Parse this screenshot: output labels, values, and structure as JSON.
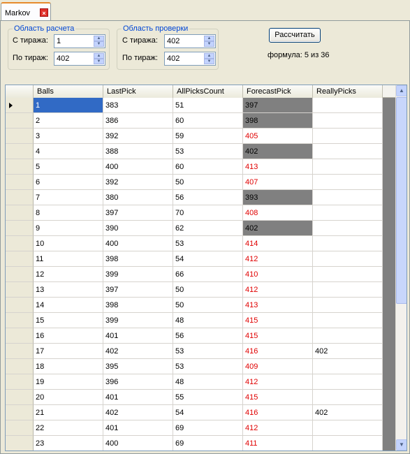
{
  "tab": {
    "label": "Markov",
    "close": "×"
  },
  "calc_group": {
    "title": "Область расчета",
    "from_label": "С тиража:",
    "from_value": "1",
    "to_label": "По тираж:",
    "to_value": "402"
  },
  "check_group": {
    "title": "Область проверки",
    "from_label": "С тиража:",
    "from_value": "402",
    "to_label": "По тираж:",
    "to_value": "402"
  },
  "calculate_button": "Рассчитать",
  "formula_text": "формула: 5 из 36",
  "grid": {
    "columns": [
      "Balls",
      "LastPick",
      "AllPicksCount",
      "ForecastPick",
      "ReallyPicks"
    ],
    "rows": [
      {
        "balls": "1",
        "last": "383",
        "all": "51",
        "forecast": "397",
        "really": "",
        "style": "gray"
      },
      {
        "balls": "2",
        "last": "386",
        "all": "60",
        "forecast": "398",
        "really": "",
        "style": "gray"
      },
      {
        "balls": "3",
        "last": "392",
        "all": "59",
        "forecast": "405",
        "really": "",
        "style": "red"
      },
      {
        "balls": "4",
        "last": "388",
        "all": "53",
        "forecast": "402",
        "really": "",
        "style": "gray"
      },
      {
        "balls": "5",
        "last": "400",
        "all": "60",
        "forecast": "413",
        "really": "",
        "style": "red"
      },
      {
        "balls": "6",
        "last": "392",
        "all": "50",
        "forecast": "407",
        "really": "",
        "style": "red"
      },
      {
        "balls": "7",
        "last": "380",
        "all": "56",
        "forecast": "393",
        "really": "",
        "style": "gray"
      },
      {
        "balls": "8",
        "last": "397",
        "all": "70",
        "forecast": "408",
        "really": "",
        "style": "red"
      },
      {
        "balls": "9",
        "last": "390",
        "all": "62",
        "forecast": "402",
        "really": "",
        "style": "gray"
      },
      {
        "balls": "10",
        "last": "400",
        "all": "53",
        "forecast": "414",
        "really": "",
        "style": "red"
      },
      {
        "balls": "11",
        "last": "398",
        "all": "54",
        "forecast": "412",
        "really": "",
        "style": "red"
      },
      {
        "balls": "12",
        "last": "399",
        "all": "66",
        "forecast": "410",
        "really": "",
        "style": "red"
      },
      {
        "balls": "13",
        "last": "397",
        "all": "50",
        "forecast": "412",
        "really": "",
        "style": "red"
      },
      {
        "balls": "14",
        "last": "398",
        "all": "50",
        "forecast": "413",
        "really": "",
        "style": "red"
      },
      {
        "balls": "15",
        "last": "399",
        "all": "48",
        "forecast": "415",
        "really": "",
        "style": "red"
      },
      {
        "balls": "16",
        "last": "401",
        "all": "56",
        "forecast": "415",
        "really": "",
        "style": "red"
      },
      {
        "balls": "17",
        "last": "402",
        "all": "53",
        "forecast": "416",
        "really": "402",
        "style": "red"
      },
      {
        "balls": "18",
        "last": "395",
        "all": "53",
        "forecast": "409",
        "really": "",
        "style": "red"
      },
      {
        "balls": "19",
        "last": "396",
        "all": "48",
        "forecast": "412",
        "really": "",
        "style": "red"
      },
      {
        "balls": "20",
        "last": "401",
        "all": "55",
        "forecast": "415",
        "really": "",
        "style": "red"
      },
      {
        "balls": "21",
        "last": "402",
        "all": "54",
        "forecast": "416",
        "really": "402",
        "style": "red"
      },
      {
        "balls": "22",
        "last": "401",
        "all": "69",
        "forecast": "412",
        "really": "",
        "style": "red"
      },
      {
        "balls": "23",
        "last": "400",
        "all": "69",
        "forecast": "411",
        "really": "",
        "style": "red"
      }
    ]
  },
  "colors": {
    "forecast_red": "#e00000",
    "highlight_gray": "#808080",
    "selection": "#316ac5"
  }
}
